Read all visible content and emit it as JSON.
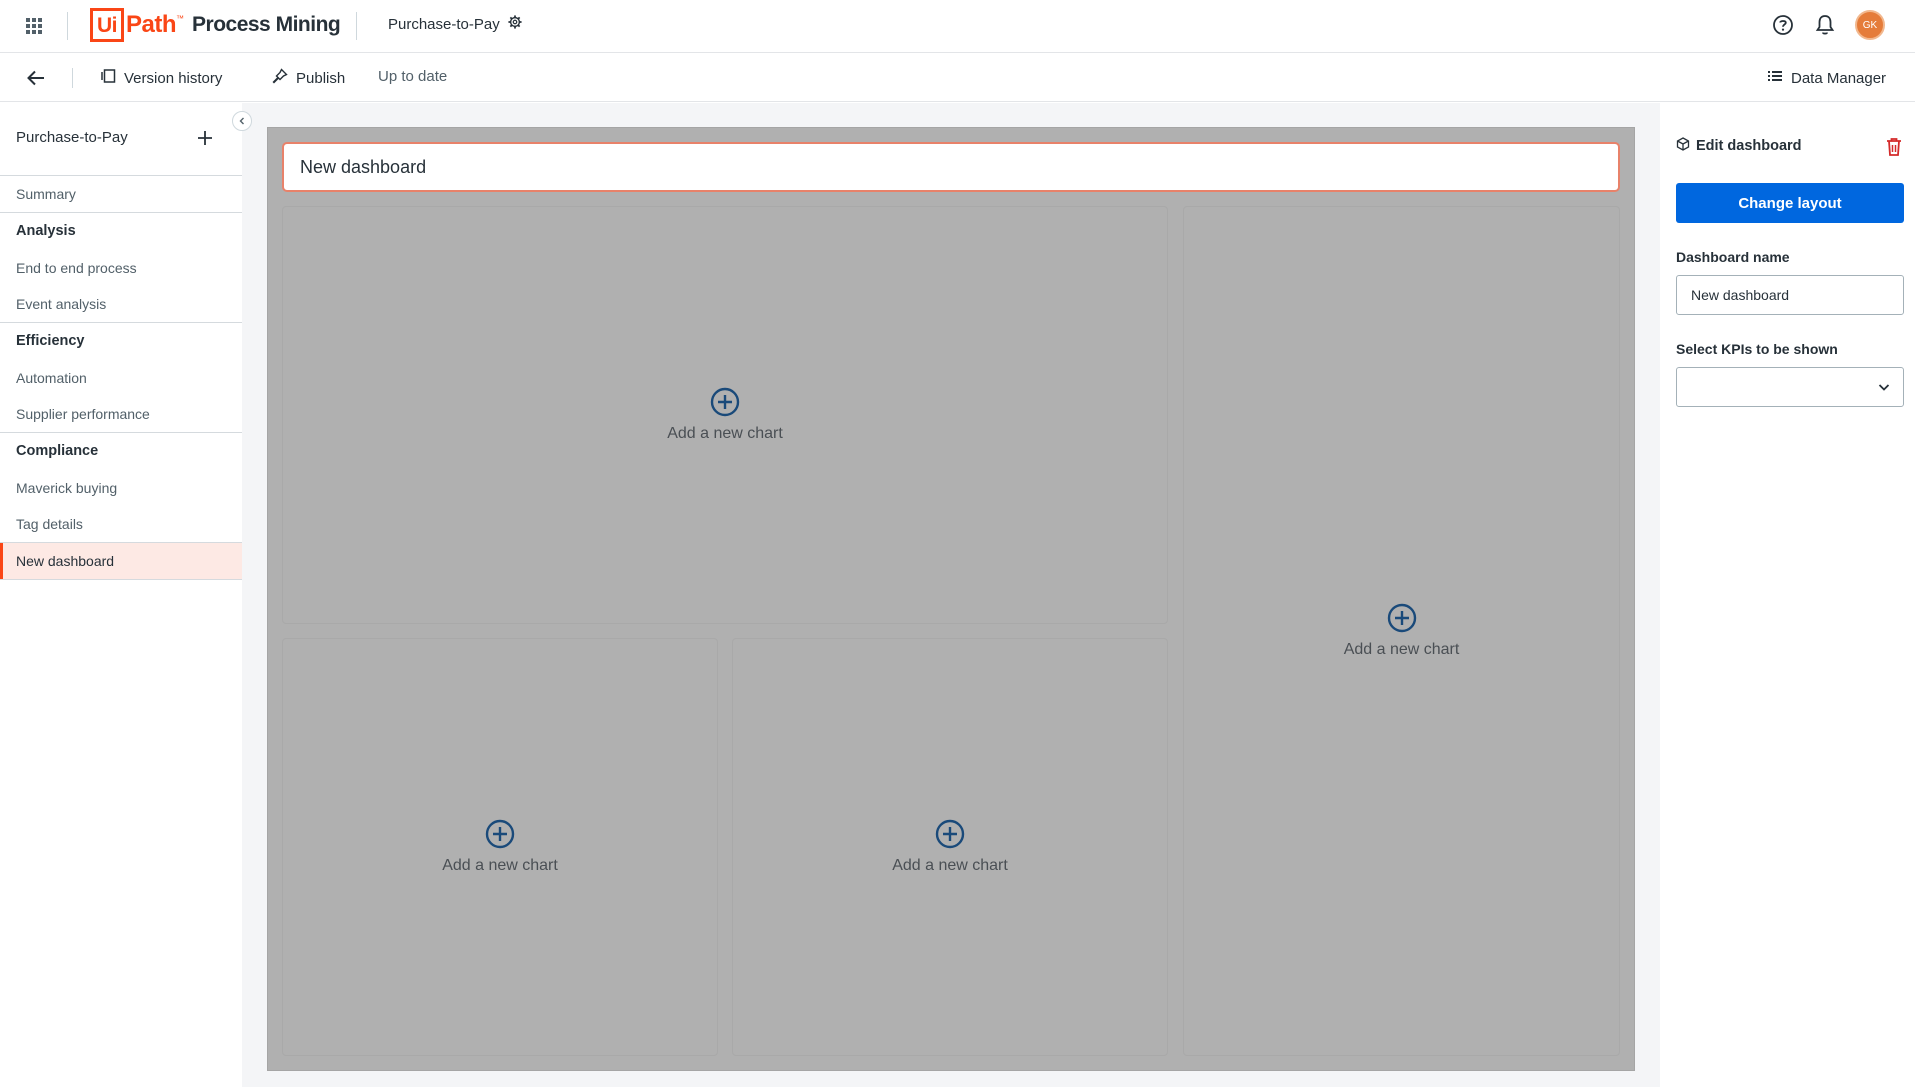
{
  "header": {
    "logo_ui": "Ui",
    "logo_path": "Path",
    "logo_tm": "™",
    "product": "Process Mining",
    "process_name": "Purchase-to-Pay",
    "avatar_initials": "GK"
  },
  "toolbar": {
    "version_history": "Version history",
    "publish": "Publish",
    "status": "Up to date",
    "data_manager": "Data Manager"
  },
  "sidebar": {
    "title": "Purchase-to-Pay",
    "items": [
      {
        "type": "item",
        "label": "Summary"
      },
      {
        "type": "group",
        "label": "Analysis"
      },
      {
        "type": "item",
        "label": "End to end process"
      },
      {
        "type": "item",
        "label": "Event analysis"
      },
      {
        "type": "group",
        "label": "Efficiency"
      },
      {
        "type": "item",
        "label": "Automation"
      },
      {
        "type": "item",
        "label": "Supplier performance"
      },
      {
        "type": "group",
        "label": "Compliance"
      },
      {
        "type": "item",
        "label": "Maverick buying"
      },
      {
        "type": "item",
        "label": "Tag details"
      },
      {
        "type": "item",
        "label": "New dashboard",
        "active": true
      }
    ]
  },
  "dashboard": {
    "title": "New dashboard",
    "add_chart_label": "Add a new chart"
  },
  "panel": {
    "title": "Edit dashboard",
    "change_layout": "Change layout",
    "name_label": "Dashboard name",
    "name_value": "New dashboard",
    "kpi_label": "Select KPIs to be shown",
    "kpi_value": ""
  },
  "colors": {
    "brand": "#fa4616",
    "primary": "#0067df",
    "canvas": "#b0b0b0",
    "active_bg": "#fde9e4",
    "add_icon": "#1a4a7a",
    "delete": "#d42a2a"
  }
}
